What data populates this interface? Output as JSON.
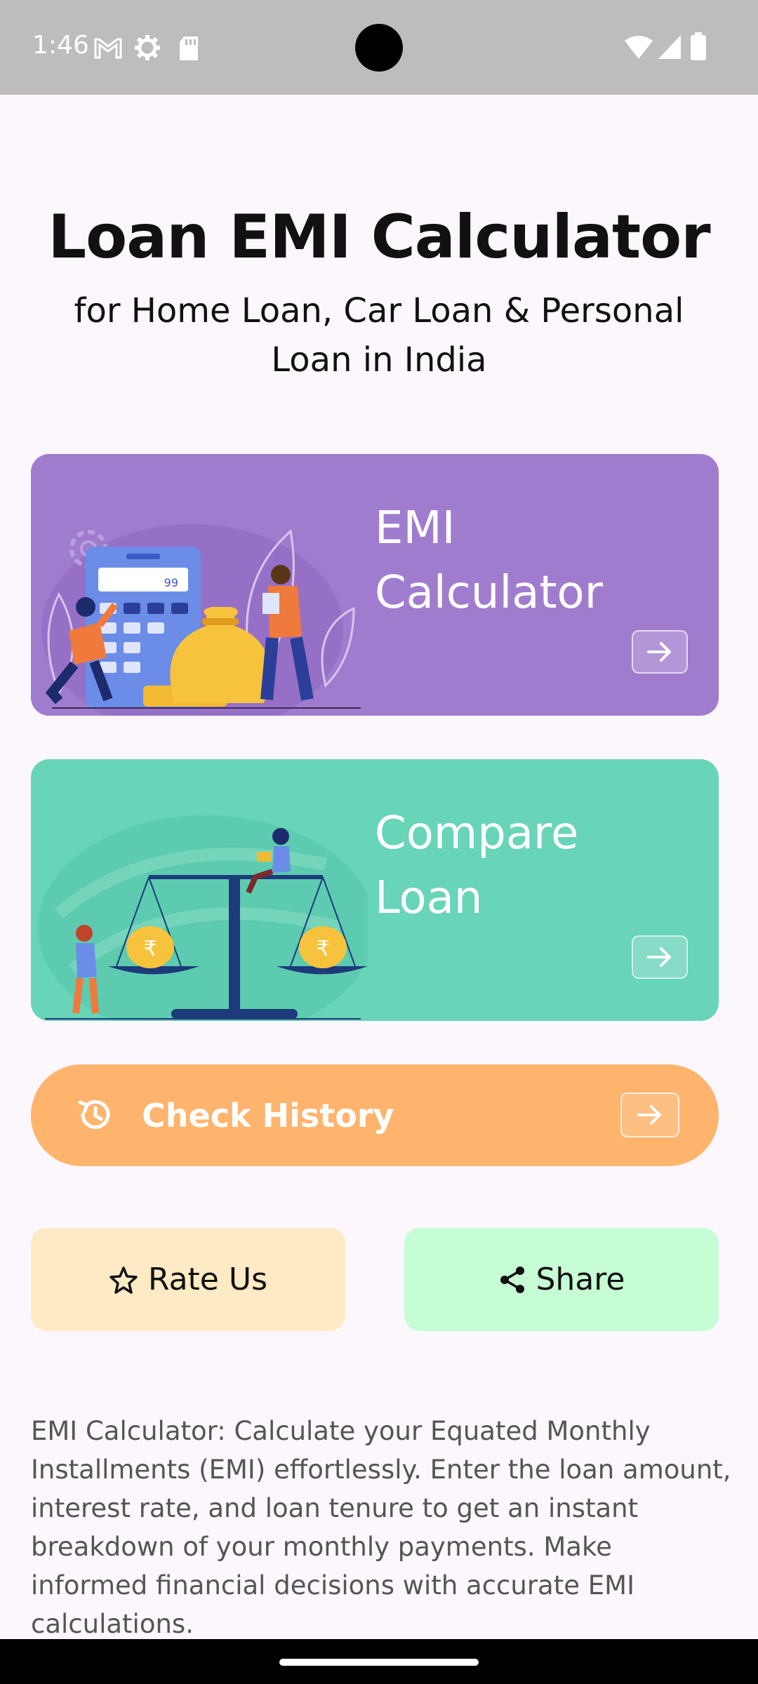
{
  "status_bar": {
    "time": "1:46",
    "icons_left": [
      "gmail-icon",
      "settings-gear-icon",
      "sd-card-icon"
    ],
    "icons_right": [
      "wifi-icon",
      "signal-icon",
      "battery-icon"
    ]
  },
  "header": {
    "title": "Loan EMI Calculator",
    "subtitle": "for Home Loan, Car Loan & Personal Loan in India"
  },
  "cards": {
    "emi": {
      "title_line1": "EMI",
      "title_line2": "Calculator",
      "calculator_display": "99",
      "color": "#a07cce"
    },
    "compare": {
      "title_line1": "Compare",
      "title_line2": "Loan",
      "color": "#68d4b8"
    }
  },
  "history": {
    "label": "Check History",
    "color": "#feb46d"
  },
  "buttons": {
    "rate": "Rate Us",
    "share": "Share"
  },
  "description": "EMI Calculator: Calculate your Equated Monthly Installments (EMI) effortlessly. Enter the loan amount, interest rate, and loan tenure to get an instant breakdown of your monthly payments. Make informed financial decisions with accurate EMI calculations."
}
